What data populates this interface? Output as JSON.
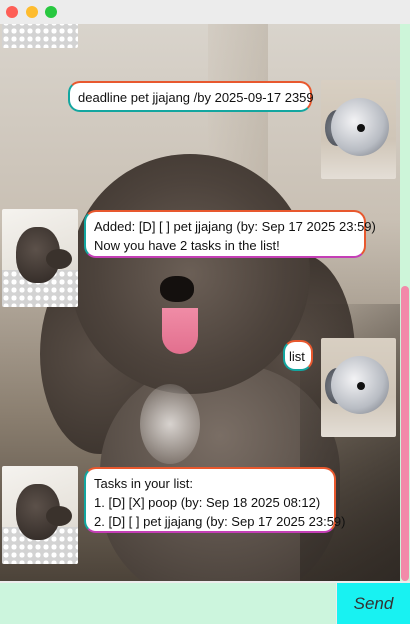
{
  "window": {
    "controls": [
      "close",
      "minimize",
      "maximize"
    ]
  },
  "messages": [
    {
      "from": "user",
      "text": "deadline pet jjajang /by 2025-09-17 2359"
    },
    {
      "from": "bot",
      "lines": [
        "Added: [D] [ ] pet jjajang (by: Sep 17 2025 23:59)",
        "Now you have 2 tasks in the list!"
      ]
    },
    {
      "from": "user",
      "text": "list"
    },
    {
      "from": "bot",
      "lines": [
        "Tasks in your list:",
        "1. [D] [X] poop (by: Sep 18 2025 08:12)",
        "2. [D] [ ] pet jjajang (by: Sep 17 2025 23:59)"
      ]
    }
  ],
  "input": {
    "value": "",
    "placeholder": ""
  },
  "send": {
    "label": "Send"
  },
  "colors": {
    "input_bg": "#ccf5dd",
    "send_bg": "#18f2f2",
    "scroll_thumb": "#f28aa9",
    "bubble_border_top": "#e8582e",
    "bubble_border_left": "#13a6a0"
  }
}
